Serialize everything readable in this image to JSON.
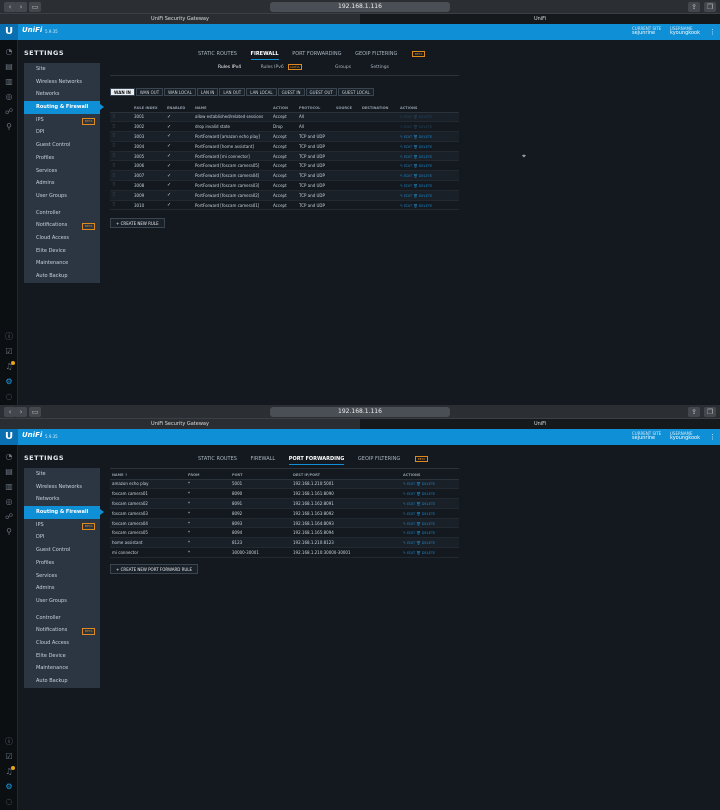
{
  "browser": {
    "url": "192.168.1.116",
    "tab_left": "UniFi Security Gateway",
    "tab_right": "UniFi"
  },
  "header": {
    "brand": "UniFi",
    "version": "5.9.35",
    "site_label": "CURRENT SITE",
    "site": "sejunrine",
    "user_label": "USERNAME",
    "user": "kyoungkook"
  },
  "settings_title": "SETTINGS",
  "sidebar_top": [
    "Site",
    "Wireless Networks",
    "Networks",
    "Routing & Firewall",
    "IPS",
    "DPI",
    "Guest Control",
    "Profiles",
    "Services",
    "Admins",
    "User Groups"
  ],
  "sidebar_bottom": [
    "Controller",
    "Notifications",
    "Cloud Access",
    "Elite Device",
    "Maintenance",
    "Auto Backup"
  ],
  "beta": "BETA",
  "alpha": "ALPHA",
  "tabs": [
    "STATIC ROUTES",
    "FIREWALL",
    "PORT FORWARDING",
    "GEOIP FILTERING"
  ],
  "firewall": {
    "subtabs": [
      "Rules IPv4",
      "Rules IPv6",
      "Groups",
      "Settings"
    ],
    "filters": [
      "WAN IN",
      "WAN OUT",
      "WAN LOCAL",
      "LAN IN",
      "LAN OUT",
      "LAN LOCAL",
      "GUEST IN",
      "GUEST OUT",
      "GUEST LOCAL"
    ],
    "columns": [
      "RULE INDEX",
      "ENABLED",
      "NAME",
      "ACTION",
      "PROTOCOL",
      "SOURCE",
      "DESTINATION",
      "ACTIONS"
    ],
    "rows": [
      {
        "index": "3001",
        "name": "allow established/related sessions",
        "action": "Accept",
        "protocol": "All"
      },
      {
        "index": "3002",
        "name": "drop invalid state",
        "action": "Drop",
        "protocol": "All"
      },
      {
        "index": "3003",
        "name": "PortForward [amazon echo play]",
        "action": "Accept",
        "protocol": "TCP and UDP"
      },
      {
        "index": "3004",
        "name": "PortForward [home assistant]",
        "action": "Accept",
        "protocol": "TCP and UDP"
      },
      {
        "index": "3005",
        "name": "PortForward [mi connector]",
        "action": "Accept",
        "protocol": "TCP and UDP"
      },
      {
        "index": "3006",
        "name": "PortForward [foscam camera05]",
        "action": "Accept",
        "protocol": "TCP and UDP"
      },
      {
        "index": "3007",
        "name": "PortForward [foscam camera04]",
        "action": "Accept",
        "protocol": "TCP and UDP"
      },
      {
        "index": "3008",
        "name": "PortForward [foscam camera03]",
        "action": "Accept",
        "protocol": "TCP and UDP"
      },
      {
        "index": "3009",
        "name": "PortForward [foscam camera02]",
        "action": "Accept",
        "protocol": "TCP and UDP"
      },
      {
        "index": "3010",
        "name": "PortForward [foscam camera01]",
        "action": "Accept",
        "protocol": "TCP and UDP"
      }
    ],
    "new_button": "CREATE NEW RULE"
  },
  "port_forwarding": {
    "columns": [
      "NAME",
      "FROM",
      "PORT",
      "DEST IP/PORT",
      "ACTIONS"
    ],
    "rows": [
      {
        "name": "amazon echo play",
        "from": "*",
        "port": "5001",
        "dest": "192.168.1.210:5001"
      },
      {
        "name": "foscam camera01",
        "from": "*",
        "port": "8090",
        "dest": "192.168.1.161:8090"
      },
      {
        "name": "foscam camera02",
        "from": "*",
        "port": "8091",
        "dest": "192.168.1.162:8091"
      },
      {
        "name": "foscam camera03",
        "from": "*",
        "port": "8092",
        "dest": "192.168.1.163:8092"
      },
      {
        "name": "foscam camera04",
        "from": "*",
        "port": "8093",
        "dest": "192.168.1.164:8093"
      },
      {
        "name": "foscam camera05",
        "from": "*",
        "port": "8094",
        "dest": "192.168.1.165:8094"
      },
      {
        "name": "home assistant",
        "from": "*",
        "port": "8123",
        "dest": "192.168.1.210:8123"
      },
      {
        "name": "mi connector",
        "from": "*",
        "port": "30000-30001",
        "dest": "192.168.1.210:30000-30001"
      }
    ],
    "new_button": "CREATE NEW PORT FORWARD RULE"
  },
  "edit": "EDIT",
  "delete": "DELETE",
  "check": "✓",
  "icons": {
    "rail": [
      "dashboard-icon",
      "stats-icon",
      "map-icon",
      "devices-icon",
      "clients-icon",
      "insights-icon"
    ],
    "rail_bottom": [
      "info-icon",
      "events-icon",
      "alerts-icon",
      "settings-icon",
      "chat-icon"
    ]
  },
  "colors": {
    "accent": "#0f8fd6",
    "beta": "#e08a1e",
    "bg": "#14191f"
  }
}
